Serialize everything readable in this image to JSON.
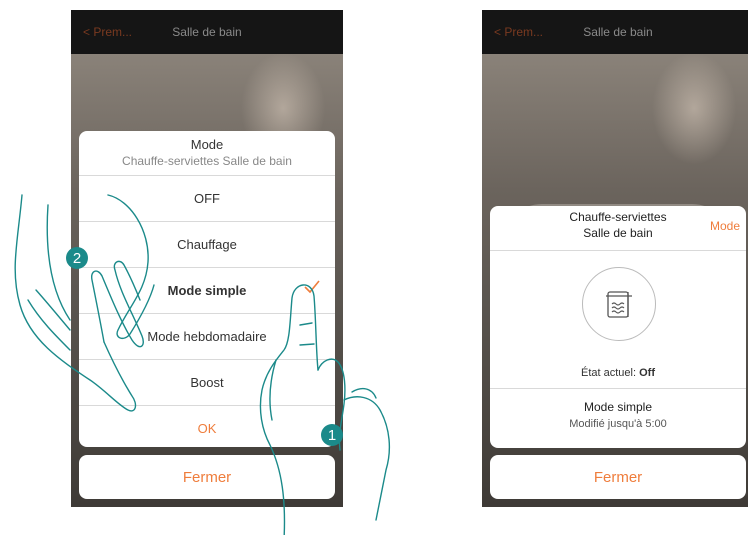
{
  "left_screen": {
    "back_label": "Prem...",
    "title": "Salle de bain",
    "sheet": {
      "title": "Mode",
      "subtitle": "Chauffe-serviettes Salle de bain",
      "options": [
        {
          "label": "OFF",
          "selected": false
        },
        {
          "label": "Chauffage",
          "selected": false
        },
        {
          "label": "Mode simple",
          "selected": true
        },
        {
          "label": "Mode hebdomadaire",
          "selected": false
        },
        {
          "label": "Boost",
          "selected": false
        }
      ],
      "ok_label": "OK"
    },
    "close_label": "Fermer"
  },
  "right_screen": {
    "back_label": "Prem...",
    "title": "Salle de bain",
    "sheet": {
      "device_name_line1": "Chauffe-serviettes",
      "device_name_line2": "Salle de bain",
      "mode_link": "Mode",
      "device_icon": "towel-warmer-icon",
      "state_label": "État actuel:",
      "state_value": "Off",
      "mode_name": "Mode simple",
      "mode_until": "Modifié jusqu'à 5:00"
    },
    "close_label": "Fermer"
  },
  "annotations": {
    "step1": "1",
    "step2": "2"
  },
  "colors": {
    "accent": "#ef7d3c",
    "badge": "#1b8a8a",
    "topbar": "#151515"
  }
}
